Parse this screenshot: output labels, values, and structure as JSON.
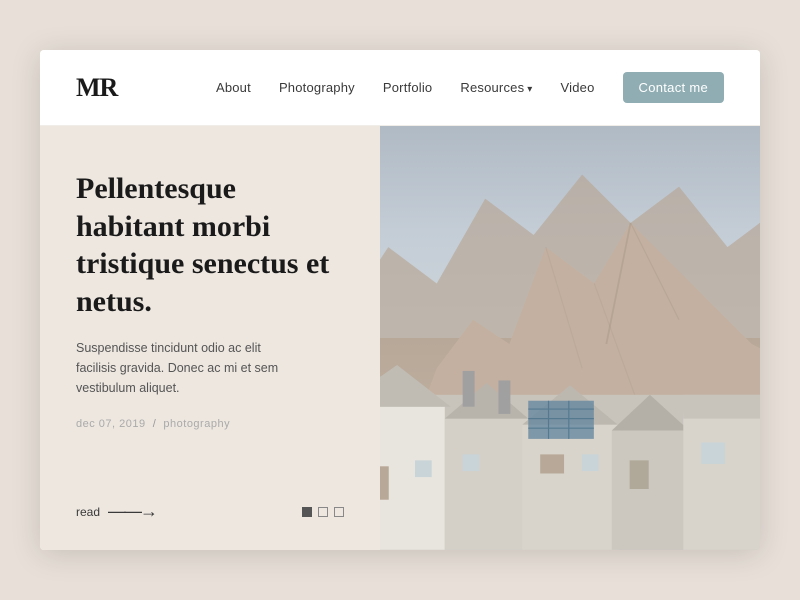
{
  "site": {
    "logo": "MR"
  },
  "nav": {
    "items": [
      {
        "label": "About",
        "id": "about",
        "hasDropdown": false
      },
      {
        "label": "Photography",
        "id": "photography",
        "hasDropdown": false
      },
      {
        "label": "Portfolio",
        "id": "portfolio",
        "hasDropdown": false
      },
      {
        "label": "Resources",
        "id": "resources",
        "hasDropdown": true
      },
      {
        "label": "Video",
        "id": "video",
        "hasDropdown": false
      }
    ],
    "cta": "Contact me"
  },
  "hero": {
    "title": "Pellentesque habitant morbi tristique senectus et netus.",
    "excerpt": "Suspendisse tincidunt odio ac elit facilisis gravida. Donec ac mi et sem vestibulum aliquet.",
    "meta_date": "dec 07, 2019",
    "meta_category": "photography",
    "read_label": "read",
    "read_arrow": "——>"
  },
  "indicators": [
    {
      "active": true
    },
    {
      "active": false
    },
    {
      "active": false
    }
  ],
  "colors": {
    "bg": "#e8e0d8",
    "card_bg": "#ede7e0",
    "contact_btn": "#8fadb3",
    "text_dark": "#1a1a1a",
    "text_mid": "#555",
    "text_light": "#999"
  }
}
